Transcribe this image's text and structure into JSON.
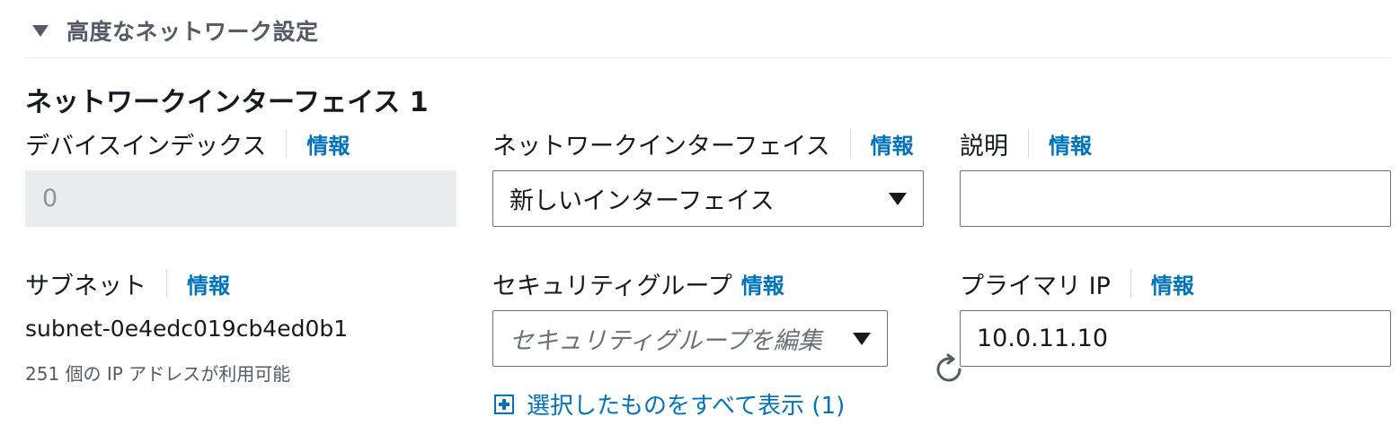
{
  "section": {
    "title": "高度なネットワーク設定"
  },
  "network_interface": {
    "title": "ネットワークインターフェイス 1",
    "info_label": "情報",
    "device_index": {
      "label": "デバイスインデックス",
      "value": "0"
    },
    "interface": {
      "label": "ネットワークインターフェイス",
      "selected": "新しいインターフェイス"
    },
    "description": {
      "label": "説明",
      "value": ""
    },
    "subnet": {
      "label": "サブネット",
      "value": "subnet-0e4edc019cb4ed0b1",
      "available": "251 個の IP アドレスが利用可能"
    },
    "security_group": {
      "label": "セキュリティグループ",
      "placeholder": "セキュリティグループを編集",
      "show_selected": "選択したものをすべて表示 (1)"
    },
    "primary_ip": {
      "label": "プライマリ IP",
      "value": "10.0.11.10"
    }
  },
  "icons": {
    "expand": "caret-down-icon",
    "dropdown": "caret-down-icon",
    "add": "plus-square-icon",
    "refresh": "refresh-icon"
  },
  "colors": {
    "link": "#0073bb",
    "text": "#16191f",
    "muted": "#545b64",
    "disabled_bg": "#eaeded"
  }
}
